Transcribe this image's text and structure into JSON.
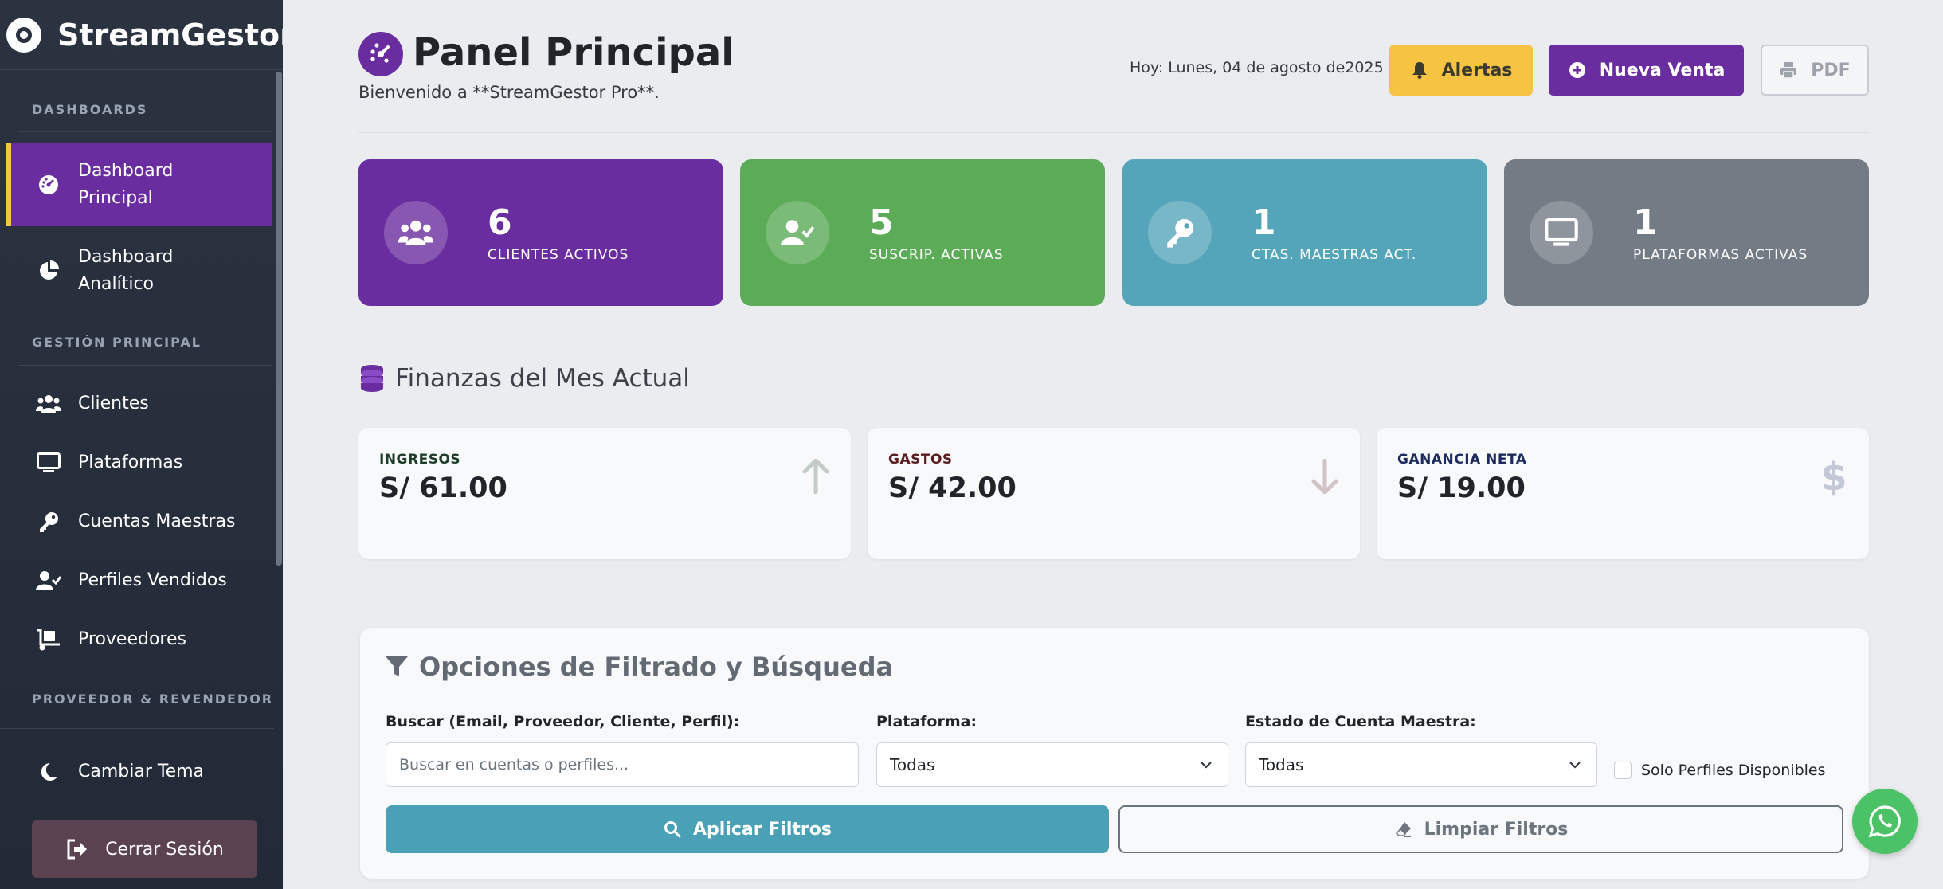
{
  "brand": {
    "name": "StreamGestor"
  },
  "sidebar": {
    "sections": [
      {
        "heading": "DASHBOARDS"
      },
      {
        "heading": "GESTIÓN PRINCIPAL"
      },
      {
        "heading": "PROVEEDOR & REVENDEDOR"
      }
    ],
    "items": [
      {
        "label": "Dashboard Principal",
        "icon": "gauge-icon",
        "active": true
      },
      {
        "label": "Dashboard Analítico",
        "icon": "pie-chart-icon",
        "active": false
      },
      {
        "label": "Clientes",
        "icon": "users-icon",
        "active": false
      },
      {
        "label": "Plataformas",
        "icon": "monitor-icon",
        "active": false
      },
      {
        "label": "Cuentas Maestras",
        "icon": "key-icon",
        "active": false
      },
      {
        "label": "Perfiles Vendidos",
        "icon": "user-check-icon",
        "active": false
      },
      {
        "label": "Proveedores",
        "icon": "dolly-icon",
        "active": false
      }
    ],
    "theme_toggle": {
      "label": "Cambiar Tema",
      "icon": "moon-icon"
    },
    "logout": {
      "label": "Cerrar Sesión",
      "icon": "sign-out-icon"
    }
  },
  "header": {
    "title": "Panel Principal",
    "subtitle": "Bienvenido a **StreamGestor Pro**.",
    "date": "Hoy: Lunes, 04 de agosto de2025",
    "alert_label": "Alertas",
    "new_sale_label": "Nueva Venta",
    "pdf_label": "PDF"
  },
  "stats": [
    {
      "value": "6",
      "label": "CLIENTES ACTIVOS",
      "color": "#6a2d9f",
      "icon": "users-icon"
    },
    {
      "value": "5",
      "label": "SUSCRIP. ACTIVAS",
      "color": "#5bab57",
      "icon": "user-check-icon"
    },
    {
      "value": "1",
      "label": "CTAS. MAESTRAS ACT.",
      "color": "#55a5ba",
      "icon": "key-icon"
    },
    {
      "value": "1",
      "label": "PLATAFORMAS ACTIVAS",
      "color": "#737b84",
      "icon": "monitor-icon"
    }
  ],
  "finance": {
    "title": "Finanzas del Mes Actual",
    "cards": [
      {
        "label": "INGRESOS",
        "value": "S/ 61.00",
        "label_color": "#1e3d28",
        "icon": "arrow-up-icon"
      },
      {
        "label": "GASTOS",
        "value": "S/ 42.00",
        "label_color": "#5a1d22",
        "icon": "arrow-down-icon"
      },
      {
        "label": "GANANCIA NETA",
        "value": "S/ 19.00",
        "label_color": "#1c2a5e",
        "icon": "dollar-icon"
      }
    ]
  },
  "filters": {
    "title": "Opciones de Filtrado y Búsqueda",
    "search_label": "Buscar (Email, Proveedor, Cliente, Perfil):",
    "search_placeholder": "Buscar en cuentas o perfiles...",
    "platform_label": "Plataforma:",
    "platform_value": "Todas",
    "status_label": "Estado de Cuenta Maestra:",
    "status_value": "Todas",
    "only_available_label": "Solo Perfiles Disponibles",
    "only_available_checked": false,
    "apply_label": "Aplicar Filtros",
    "clear_label": "Limpiar Filtros"
  },
  "colors": {
    "accent": "#6a2d9f",
    "warning": "#f6c343",
    "info": "#4aa0b4",
    "whatsapp": "#4cc266"
  }
}
